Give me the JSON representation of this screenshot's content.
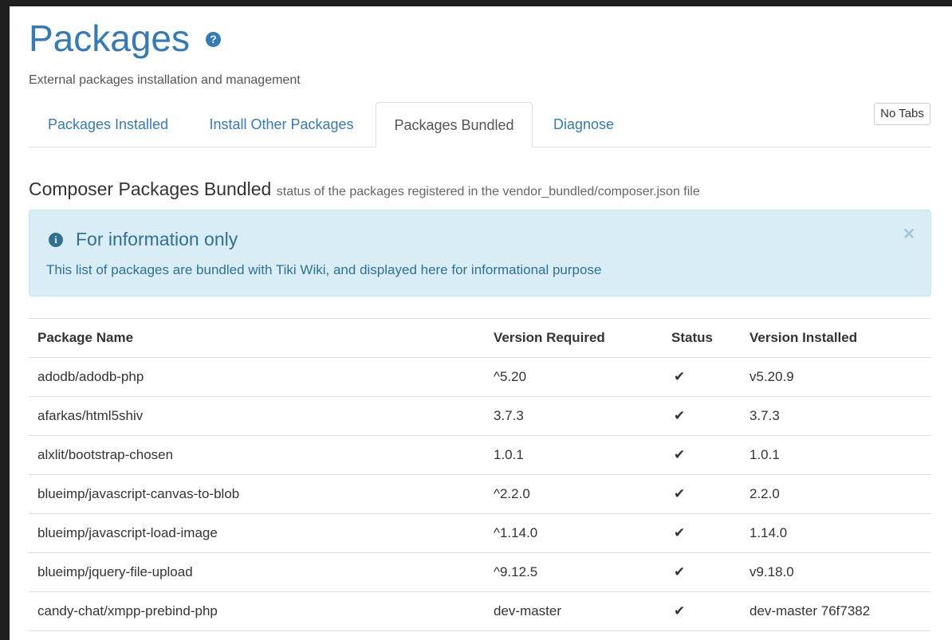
{
  "header": {
    "title": "Packages",
    "help_icon": "question-circle",
    "subtitle": "External packages installation and management"
  },
  "tabs": [
    {
      "label": "Packages Installed",
      "active": false
    },
    {
      "label": "Install Other Packages",
      "active": false
    },
    {
      "label": "Packages Bundled",
      "active": true
    },
    {
      "label": "Diagnose",
      "active": false
    }
  ],
  "no_tabs_label": "No Tabs",
  "section": {
    "title": "Composer Packages Bundled",
    "subtitle": "status of the packages registered in the vendor_bundled/composer.json file"
  },
  "alert": {
    "icon": "info-circle",
    "title": "For information only",
    "text": "This list of packages are bundled with Tiki Wiki, and displayed here for informational purpose",
    "close": "×"
  },
  "table": {
    "columns": [
      "Package Name",
      "Version Required",
      "Status",
      "Version Installed"
    ],
    "rows": [
      {
        "name": "adodb/adodb-php",
        "required": "^5.20",
        "status": "✔",
        "installed": "v5.20.9"
      },
      {
        "name": "afarkas/html5shiv",
        "required": "3.7.3",
        "status": "✔",
        "installed": "3.7.3"
      },
      {
        "name": "alxlit/bootstrap-chosen",
        "required": "1.0.1",
        "status": "✔",
        "installed": "1.0.1"
      },
      {
        "name": "blueimp/javascript-canvas-to-blob",
        "required": "^2.2.0",
        "status": "✔",
        "installed": "2.2.0"
      },
      {
        "name": "blueimp/javascript-load-image",
        "required": "^1.14.0",
        "status": "✔",
        "installed": "1.14.0"
      },
      {
        "name": "blueimp/jquery-file-upload",
        "required": "^9.12.5",
        "status": "✔",
        "installed": "v9.18.0"
      },
      {
        "name": "candy-chat/xmpp-prebind-php",
        "required": "dev-master",
        "status": "✔",
        "installed": "dev-master 76f7382"
      }
    ]
  },
  "colors": {
    "link": "#337ab7",
    "alert_bg": "#d9edf7",
    "alert_text": "#31708f"
  }
}
